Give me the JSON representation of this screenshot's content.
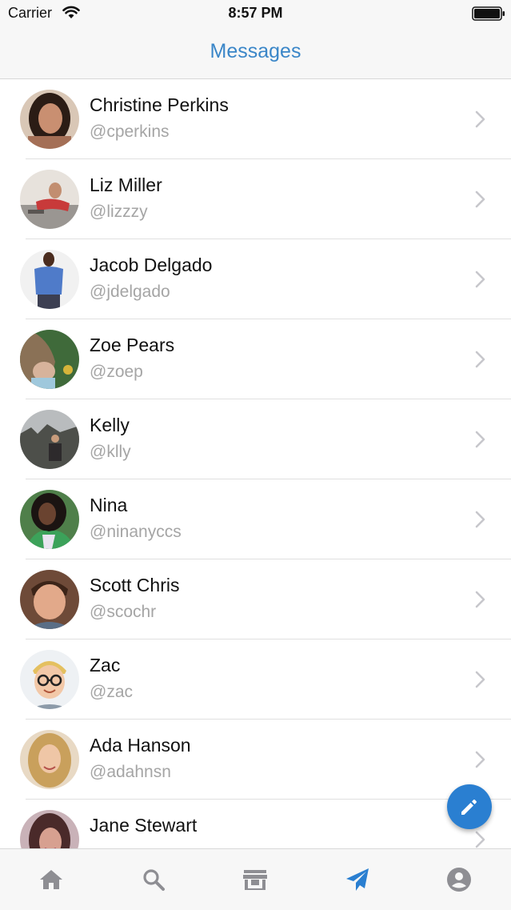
{
  "status_bar": {
    "carrier": "Carrier",
    "time": "8:57 PM"
  },
  "nav": {
    "title": "Messages"
  },
  "contacts": [
    {
      "name": "Christine Perkins",
      "handle": "@cperkins"
    },
    {
      "name": "Liz Miller",
      "handle": "@lizzzy"
    },
    {
      "name": "Jacob Delgado",
      "handle": "@jdelgado"
    },
    {
      "name": "Zoe Pears",
      "handle": "@zoep"
    },
    {
      "name": "Kelly",
      "handle": "@klly"
    },
    {
      "name": "Nina",
      "handle": "@ninanyccs"
    },
    {
      "name": "Scott Chris",
      "handle": "@scochr"
    },
    {
      "name": "Zac",
      "handle": "@zac"
    },
    {
      "name": "Ada Hanson",
      "handle": "@adahnsn"
    },
    {
      "name": "Jane Stewart",
      "handle": ""
    }
  ],
  "tabs": [
    {
      "icon": "home-icon",
      "active": false
    },
    {
      "icon": "search-icon",
      "active": false
    },
    {
      "icon": "store-icon",
      "active": false
    },
    {
      "icon": "send-icon",
      "active": true
    },
    {
      "icon": "account-icon",
      "active": false
    }
  ],
  "fab": {
    "icon": "pencil-icon"
  },
  "colors": {
    "accent": "#3a86c8",
    "fab": "#2a7fd1",
    "tab_inactive": "#8e8e93",
    "tab_active": "#2a7fd1",
    "handle_gray": "#a5a5a5"
  }
}
